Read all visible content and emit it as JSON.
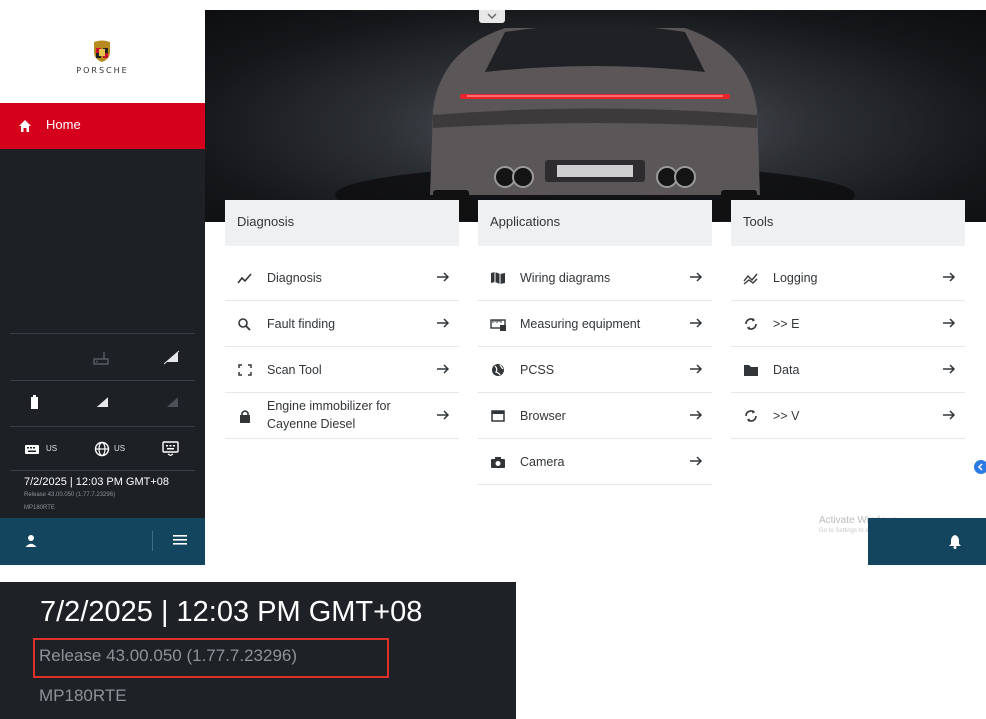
{
  "sidebar": {
    "brand": "PORSCHE",
    "home_label": "Home",
    "status_row3": {
      "keyboard": "US",
      "language": "US"
    },
    "date_time": "7/2/2025  |  12:03 PM GMT+08",
    "release": "Release 43.00.050 (1.77.7.23296)",
    "device": "MP180RTE"
  },
  "columns": [
    {
      "title": "Diagnosis",
      "items": [
        {
          "label": "Diagnosis",
          "icon": "trend-icon"
        },
        {
          "label": "Fault finding",
          "icon": "search-icon"
        },
        {
          "label": "Scan Tool",
          "icon": "scan-frame-icon"
        },
        {
          "label": "Engine immobilizer for Cayenne Diesel",
          "icon": "lock-icon"
        }
      ]
    },
    {
      "title": "Applications",
      "items": [
        {
          "label": "Wiring diagrams",
          "icon": "map-icon"
        },
        {
          "label": "Measuring equipment",
          "icon": "meter-icon"
        },
        {
          "label": "PCSS",
          "icon": "globe-icon"
        },
        {
          "label": "Browser",
          "icon": "window-icon"
        },
        {
          "label": "Camera",
          "icon": "camera-icon"
        }
      ]
    },
    {
      "title": "Tools",
      "items": [
        {
          "label": "Logging",
          "icon": "logging-icon"
        },
        {
          "label": ">> E",
          "icon": "sync-icon"
        },
        {
          "label": "Data",
          "icon": "folder-icon"
        },
        {
          "label": ">> V",
          "icon": "sync-icon"
        }
      ]
    }
  ],
  "watermark": {
    "line1": "Activate Windows",
    "line2": "Go to Settings to activate Windows."
  },
  "zoom": {
    "date_time": "7/2/2025  |  12:03 PM GMT+08",
    "release": "Release 43.00.050 (1.77.7.23296)",
    "device": "MP180RTE"
  },
  "colors": {
    "accent": "#d5001c",
    "sidebar": "#1d2126",
    "footer": "#13455f",
    "highlight_box": "#e0302b"
  }
}
